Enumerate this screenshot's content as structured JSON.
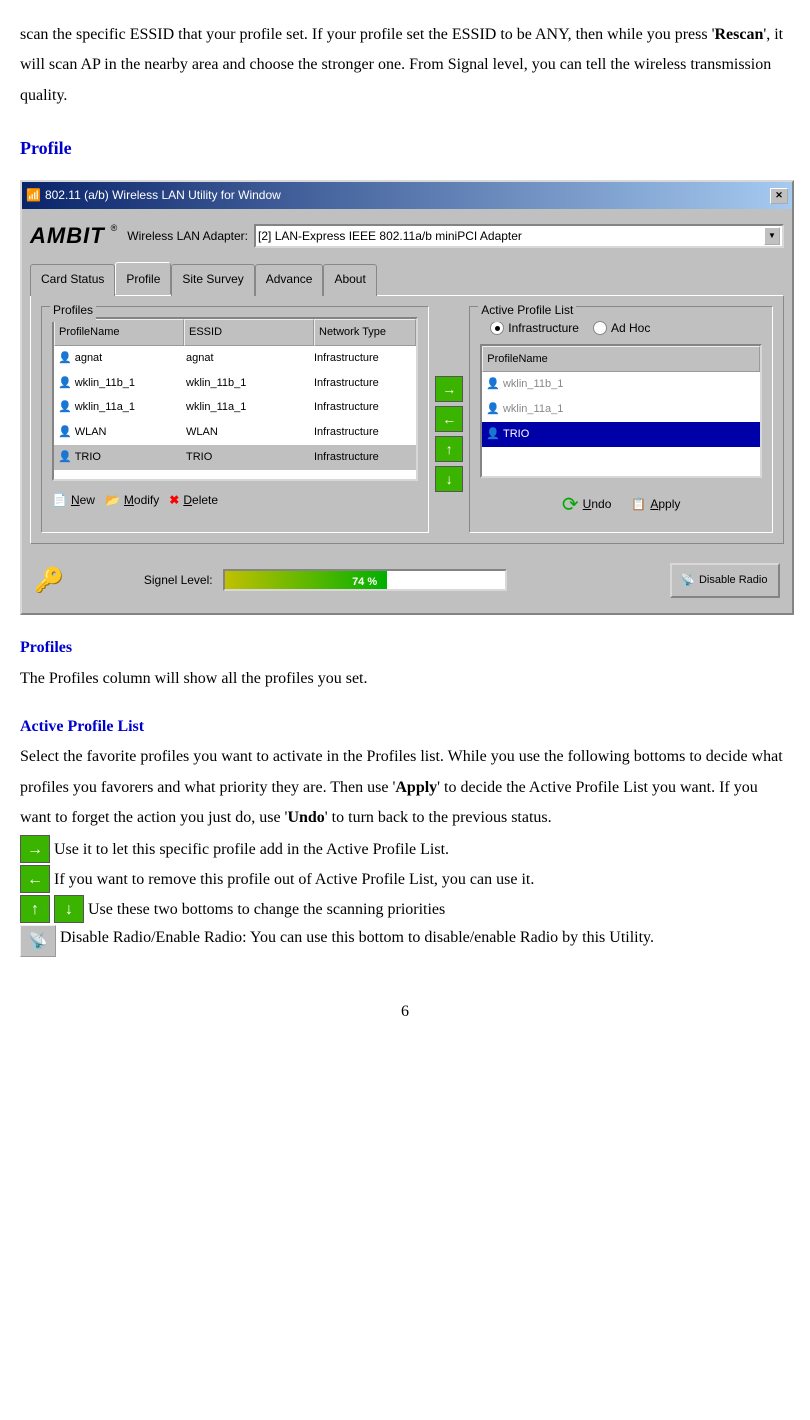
{
  "intro": {
    "line1": "scan the specific ESSID that your profile set. If your profile set the ESSID to be ANY, then while you press '",
    "rescan": "Rescan",
    "line2": "', it will scan AP in the nearby area and choose the stronger one. From Signal level, you can tell the wireless transmission quality."
  },
  "heading_profile": "Profile",
  "window": {
    "title": "802.11 (a/b) Wireless LAN Utility for Window",
    "adapter_label": "Wireless LAN Adapter:",
    "adapter_value": "[2] LAN-Express IEEE 802.11a/b miniPCI Adapter",
    "logo": "AMBIT",
    "tabs": [
      "Card Status",
      "Profile",
      "Site Survey",
      "Advance",
      "About"
    ],
    "profiles_legend": "Profiles",
    "active_legend": "Active Profile List",
    "columns": [
      "ProfileName",
      "ESSID",
      "Network Type"
    ],
    "rows": [
      {
        "name": "agnat",
        "essid": "agnat",
        "type": "Infrastructure"
      },
      {
        "name": "wklin_11b_1",
        "essid": "wklin_11b_1",
        "type": "Infrastructure"
      },
      {
        "name": "wklin_11a_1",
        "essid": "wklin_11a_1",
        "type": "Infrastructure"
      },
      {
        "name": "WLAN",
        "essid": "WLAN",
        "type": "Infrastructure"
      },
      {
        "name": "TRIO",
        "essid": "TRIO",
        "type": "Infrastructure"
      }
    ],
    "btns": {
      "new": "New",
      "modify": "Modify",
      "delete": "Delete",
      "undo": "Undo",
      "apply": "Apply"
    },
    "radio": {
      "infra": "Infrastructure",
      "adhoc": "Ad Hoc"
    },
    "active_col": "ProfileName",
    "active_rows": [
      "wklin_11b_1",
      "wklin_11a_1",
      "TRIO"
    ],
    "signal_label": "Signel Level:",
    "signal_pct": "74 %",
    "signal_width": "58%",
    "disable_radio": "Disable Radio"
  },
  "subs": {
    "profiles": "Profiles",
    "profiles_body": "The Profiles column will show all the profiles you set.",
    "active": "Active Profile List",
    "active_body1": "Select the favorite profiles you want to activate in the Profiles list. While you use the following bottoms to decide what profiles you favorers and what priority they are. Then use '",
    "apply": "Apply",
    "active_body2": "' to decide the Active Profile List you want. If you want to forget the action you just do, use '",
    "undo": "Undo",
    "active_body3": "' to turn back to the previous status.",
    "right_desc": " Use it to let this specific profile add in the Active Profile List.",
    "left_desc": " If you want to remove this profile out of Active Profile List, you can use it.",
    "updown_desc": "  Use these two bottoms to change the scanning priorities",
    "radio_desc": "  Disable Radio/Enable Radio: You can use this bottom to disable/enable Radio by this Utility."
  },
  "page_number": "6"
}
